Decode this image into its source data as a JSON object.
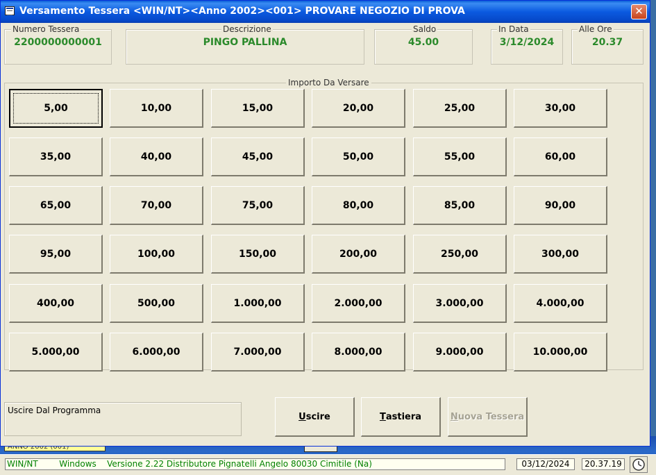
{
  "window": {
    "title": "Versamento Tessera <WIN/NT><Anno 2002><001> PROVARE NEGOZIO DI PROVA",
    "close_label": "✕"
  },
  "header": {
    "numero_tessera": {
      "label": "Numero Tessera",
      "value": "2200000000001"
    },
    "descrizione": {
      "label": "Descrizione",
      "value": "PINGO PALLINA"
    },
    "saldo": {
      "label": "Saldo",
      "value": "45.00"
    },
    "in_data": {
      "label": "In Data",
      "value": "3/12/2024"
    },
    "alle_ore": {
      "label": "Alle Ore",
      "value": "20.37"
    }
  },
  "amounts": {
    "legend": "Importo Da Versare",
    "focused": "5,00",
    "values": [
      "5,00",
      "10,00",
      "15,00",
      "20,00",
      "25,00",
      "30,00",
      "35,00",
      "40,00",
      "45,00",
      "50,00",
      "55,00",
      "60,00",
      "65,00",
      "70,00",
      "75,00",
      "80,00",
      "85,00",
      "90,00",
      "95,00",
      "100,00",
      "150,00",
      "200,00",
      "250,00",
      "300,00",
      "400,00",
      "500,00",
      "1.000,00",
      "2.000,00",
      "3.000,00",
      "4.000,00",
      "5.000,00",
      "6.000,00",
      "7.000,00",
      "8.000,00",
      "9.000,00",
      "10.000,00"
    ]
  },
  "info": {
    "text": "Uscire Dal Programma"
  },
  "commands": {
    "uscire": {
      "accel": "U",
      "rest": "scire"
    },
    "tastiera": {
      "accel": "T",
      "rest": "astiera"
    },
    "nuova_tessera": {
      "accel": "N",
      "rest": "uova Tessera",
      "enabled": false
    }
  },
  "desktop": {
    "label": "ANNO 2002 (001)"
  },
  "statusbar": {
    "main": "WIN/NT        Windows    Versione 2.22 Distributore Pignatelli Angelo 80030 Cimitile (Na)",
    "date": "03/12/2024",
    "time": "20.37.19",
    "icon": "clock-icon"
  }
}
